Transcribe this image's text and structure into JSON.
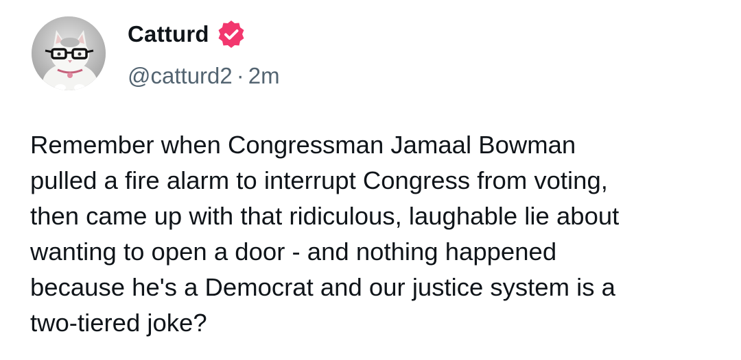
{
  "author": {
    "display_name": "Catturd",
    "handle": "@catturd2",
    "separator": "·",
    "timestamp": "2m",
    "verified": true,
    "verified_badge_color": "#f2376e"
  },
  "post": {
    "text": "Remember when Congressman Jamaal Bowman\npulled a fire alarm to interrupt Congress from voting,\nthen came up with that ridiculous, laughable lie about\nwanting to open a door - and nothing happened\nbecause he's a Democrat and our justice system is a\ntwo-tiered joke?"
  },
  "icons": {
    "avatar": "cat-with-glasses-avatar",
    "badge": "verified-badge-icon"
  }
}
